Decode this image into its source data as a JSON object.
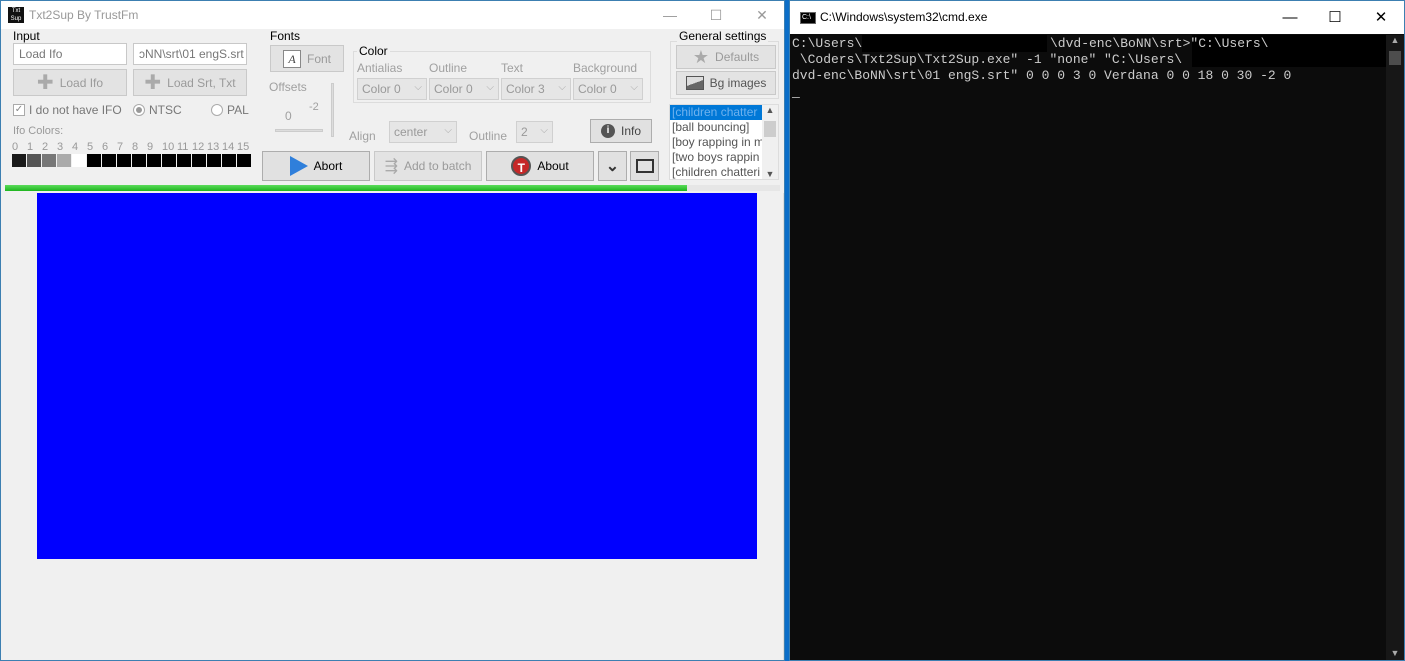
{
  "app": {
    "title": "Txt2Sup By TrustFm",
    "input": {
      "group": "Input",
      "ifo_field": "Load Ifo",
      "srt_field": "ɔNN\\srt\\01 engS.srt",
      "load_ifo": "Load Ifo",
      "load_srt": "Load Srt, Txt",
      "no_ifo": "I do not have IFO",
      "ntsc": "NTSC",
      "pal": "PAL",
      "ifo_colors": "Ifo Colors:",
      "color_indices": [
        "0",
        "1",
        "2",
        "3",
        "4",
        "5",
        "6",
        "7",
        "8",
        "9",
        "10",
        "11",
        "12",
        "13",
        "14",
        "15"
      ],
      "color_swatches": [
        "#1a1a1a",
        "#555555",
        "#777777",
        "#aaaaaa",
        "#ffffff",
        "#000000",
        "#000000",
        "#000000",
        "#000000",
        "#000000",
        "#000000",
        "#000000",
        "#000000",
        "#000000",
        "#000000",
        "#000000"
      ]
    },
    "fonts": {
      "group": "Fonts",
      "font_button": "Font",
      "offsets": "Offsets",
      "offset_x": "0",
      "offset_y": "-2",
      "align_label": "Align",
      "align_value": "center"
    },
    "color": {
      "group": "Color",
      "antialias_label": "Antialias",
      "antialias_value": "Color 0",
      "outline_label": "Outline",
      "outline_value": "Color 0",
      "text_label": "Text",
      "text_value": "Color 3",
      "background_label": "Background",
      "background_value": "Color 0",
      "outline_width_label": "Outline",
      "outline_width_value": "2",
      "info": "Info"
    },
    "general": {
      "group": "General settings",
      "defaults": "Defaults",
      "bg_images": "Bg images",
      "list": [
        "[children chatter",
        "[ball bouncing]",
        "[boy rapping in m",
        "[two boys rappin",
        "[children chatteri"
      ]
    },
    "actions": {
      "abort": "Abort",
      "add_to_batch": "Add to batch",
      "about": "About"
    },
    "progress": 0.88,
    "preview_color": "#0000ff"
  },
  "cmd": {
    "title": "C:\\Windows\\system32\\cmd.exe",
    "line1a": "C:\\Users\\",
    "line1b": "\\dvd-enc\\BoNN\\srt>\"C:\\Users\\",
    "line2": " \\Coders\\Txt2Sup\\Txt2Sup.exe\" -1 \"none\" \"C:\\Users\\",
    "line3": "dvd-enc\\BoNN\\srt\\01 engS.srt\" 0 0 0 3 0 Verdana 0 0 18 0 30 -2 0",
    "cursor": "_"
  }
}
